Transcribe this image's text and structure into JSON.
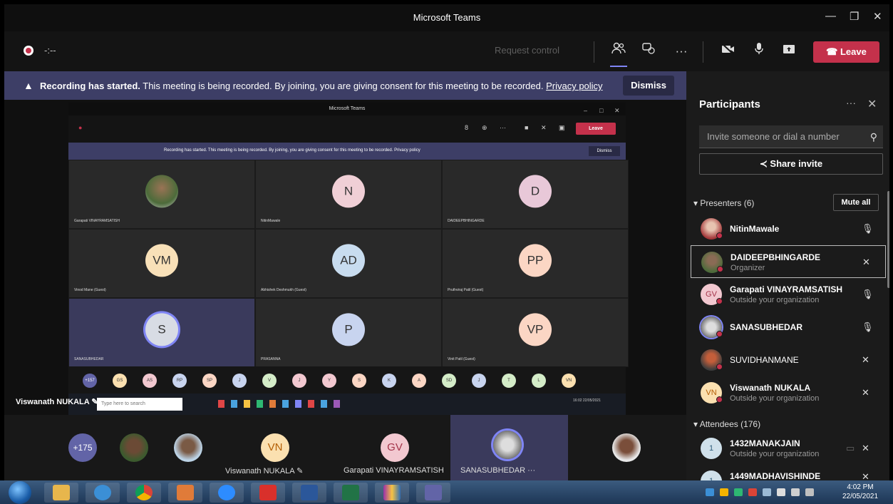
{
  "window": {
    "title": "Microsoft Teams",
    "minimize": "—",
    "maximize": "❐",
    "close": "✕"
  },
  "toolbar": {
    "timer": "-:--",
    "request_control": "Request control",
    "leave": "Leave"
  },
  "banner": {
    "bold": "Recording has started.",
    "text": "This meeting is being recorded. By joining, you are giving consent for this meeting to be recorded.",
    "link": "Privacy policy",
    "dismiss": "Dismiss"
  },
  "shared_screen": {
    "title": "Microsoft Teams",
    "leave": "Leave",
    "banner": "Recording has started.  This meeting is being recorded. By joining, you are giving consent for this meeting to be recorded. Privacy policy",
    "dismiss": "Dismiss",
    "tiles": [
      {
        "initials": "",
        "name": "Garapati VINAYRAMSATISH"
      },
      {
        "initials": "N",
        "name": "NitinMawale"
      },
      {
        "initials": "D",
        "name": "DAIDEEPBHINGARDE"
      },
      {
        "initials": "VM",
        "name": "Vinod Mane (Guest)"
      },
      {
        "initials": "AD",
        "name": "Abhishek Deshmukh (Guest)"
      },
      {
        "initials": "PP",
        "name": "Pruthviraj Patil (Guest)"
      },
      {
        "initials": "S",
        "name": "SANASUBHEDAR"
      },
      {
        "initials": "P",
        "name": "PRASANNA"
      },
      {
        "initials": "VP",
        "name": "Vinit Patil (Guest)"
      }
    ],
    "strip": [
      "+157",
      "GS",
      "AS",
      "RP",
      "SP",
      "J",
      "V",
      "J",
      "Y",
      "S",
      "K",
      "A",
      "SD",
      "J",
      "T",
      "L",
      "VN"
    ],
    "search_placeholder": "Type here to search",
    "clock": "16:02 22/05/2021"
  },
  "floating_name": "Viswanath NUKALA",
  "video_strip": {
    "more": "+175",
    "tiles": [
      {
        "initials": "VN",
        "name": "Viswanath NUKALA"
      },
      {
        "initials": "GV",
        "name": "Garapati VINAYRAMSATISH"
      },
      {
        "initials": "",
        "name": "SANASUBHEDAR"
      }
    ],
    "more_icon": "···"
  },
  "participants": {
    "title": "Participants",
    "invite_placeholder": "Invite someone or dial a number",
    "share_invite": "Share invite",
    "presenters_label": "Presenters (6)",
    "mute_all": "Mute all",
    "presenters": [
      {
        "name": "NitinMawale",
        "sub": "",
        "initials": ""
      },
      {
        "name": "DAIDEEPBHINGARDE",
        "sub": "Organizer",
        "initials": ""
      },
      {
        "name": "Garapati VINAYRAMSATISH",
        "sub": "Outside your organization",
        "initials": "GV"
      },
      {
        "name": "SANASUBHEDAR",
        "sub": "",
        "initials": ""
      },
      {
        "name": "SUVIDHANMANE",
        "sub": "",
        "initials": ""
      },
      {
        "name": "Viswanath NUKALA",
        "sub": "Outside your organization",
        "initials": "VN"
      }
    ],
    "attendees_label": "Attendees (176)",
    "attendees": [
      {
        "name": "1432MANAKJAIN",
        "sub": "Outside your organization",
        "initials": "1"
      },
      {
        "name": "1449MADHAVISHINDE",
        "sub": "",
        "initials": "1"
      }
    ]
  },
  "taskbar": {
    "time": "4:02 PM",
    "date": "22/05/2021"
  },
  "colors": {
    "accent": "#7f85f5",
    "leave": "#c4314b",
    "banner": "#3d3e66"
  }
}
